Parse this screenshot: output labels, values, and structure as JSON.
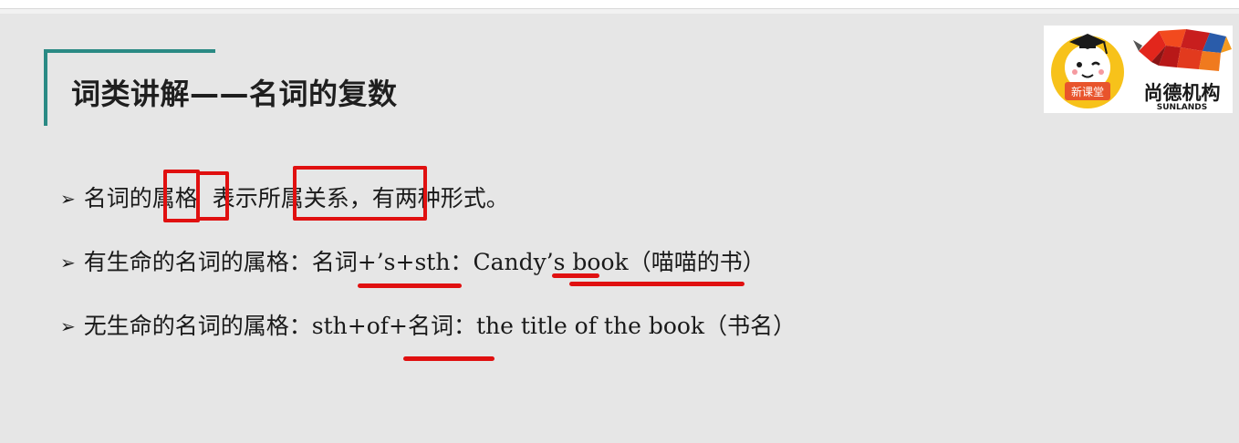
{
  "title": "词类讲解——名词的复数",
  "logo": {
    "badge_text": "新课堂",
    "brand_name": "尚德机构",
    "brand_sub": "SUNLANDS"
  },
  "bullets": [
    {
      "parts": [
        "名词的",
        "属",
        "格",
        "  表示",
        "所属关系，",
        "有两种形式。"
      ]
    },
    {
      "parts": [
        "有生命的名词的属格：",
        "名词+’s+sth：",
        "Candy’s book",
        "（喵喵的书）"
      ]
    },
    {
      "parts": [
        "无生命的名词的属格：",
        "sth+of+名词：",
        "the title of the book",
        "（书名）"
      ]
    }
  ],
  "colors": {
    "accent": "#2a8a84",
    "annotation": "#e01010",
    "background": "#e6e6e6"
  }
}
